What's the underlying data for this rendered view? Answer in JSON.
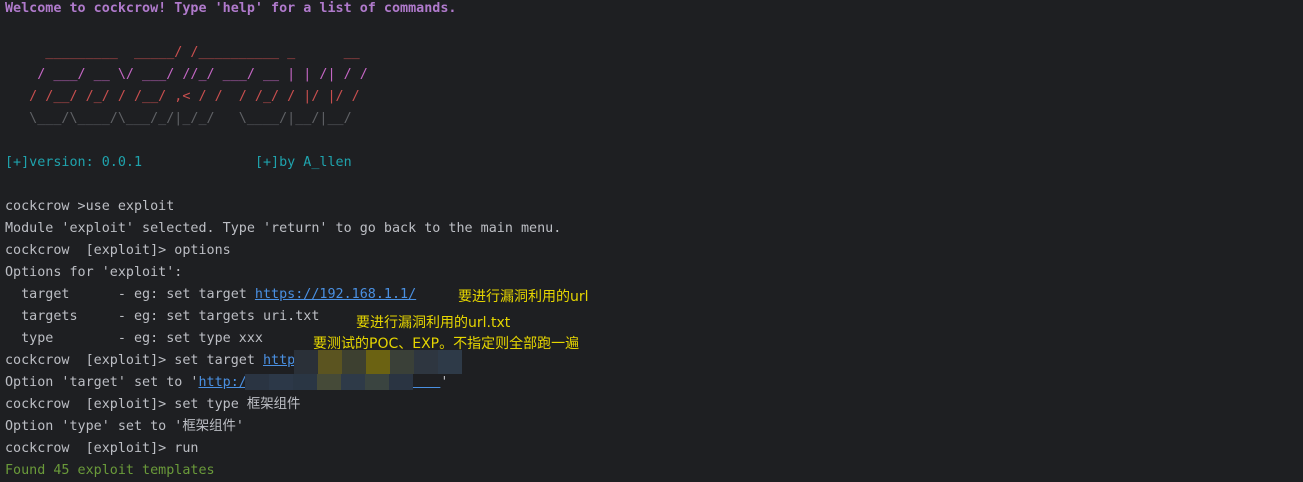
{
  "welcome": "Welcome to cockcrow! Type 'help' for a list of commands.",
  "banner": [
    "     _________  _____/ /__________ _      __",
    "    / ___/ __ \\/ ___/ //_/ ___/ __ | | /| / /",
    "   / /__/ /_/ / /__/ ,< / /  / /_/ / |/ |/ /",
    "   \\___/\\____/\\___/_/|_/_/   \\____/|__/|__/"
  ],
  "version": "[+]version: 0.0.1",
  "author": "[+]by A_llen",
  "lines": {
    "l1": "cockcrow >use exploit",
    "l2": "Module 'exploit' selected. Type 'return' to go back to the main menu.",
    "l3": "cockcrow  [exploit]> options",
    "l4": "Options for 'exploit':",
    "l5_pre": "  target      - eg: set target ",
    "l5_link": "https://192.168.1.1/",
    "l6": "  targets     - eg: set targets uri.txt",
    "l7": "  type        - eg: set type xxx",
    "l8_pre": "cockcrow  [exploit]> set target ",
    "l8_link": "http",
    "l9_pre": "Option 'target' set to '",
    "l9_link": "http:/",
    "l9_post": "'",
    "l10": "cockcrow  [exploit]> set type 框架组件",
    "l11": "Option 'type' set to '框架组件'",
    "l12": "cockcrow  [exploit]> run",
    "l13": "Found 45 exploit templates"
  },
  "annotations": {
    "target": "要进行漏洞利用的url",
    "targets": "要进行漏洞利用的url.txt",
    "type": "要测试的POC、EXP。不指定则全部跑一遍"
  },
  "colors": {
    "background": "#1e1f22",
    "annotation": "#e6d600",
    "link": "#4a90e2"
  }
}
